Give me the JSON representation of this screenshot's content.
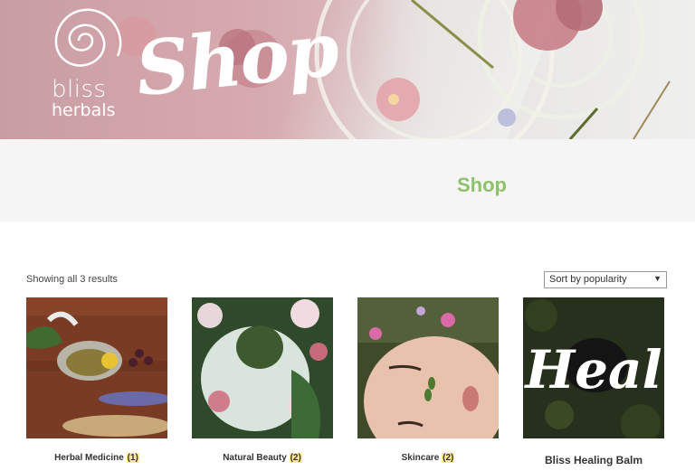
{
  "banner": {
    "logo_line1": "bliss",
    "logo_line2": "herbals",
    "title": "Shop"
  },
  "page_title": "Shop",
  "toolbar": {
    "result_count": "Showing all 3 results",
    "sort_selected": "Sort by popularity"
  },
  "products": [
    {
      "name": "Herbal Medicine",
      "count": "(1)"
    },
    {
      "name": "Natural Beauty",
      "count": "(2)"
    },
    {
      "name": "Skincare",
      "count": "(2)"
    },
    {
      "name": "Bliss Healing Balm",
      "overlay_text": "Heal"
    }
  ],
  "colors": {
    "accent_green": "#8dc26a",
    "banner_pink": "#d6a9ae",
    "count_highlight": "#ffea94"
  },
  "icons": [
    "spiral-logo-icon",
    "chevron-down-icon"
  ]
}
